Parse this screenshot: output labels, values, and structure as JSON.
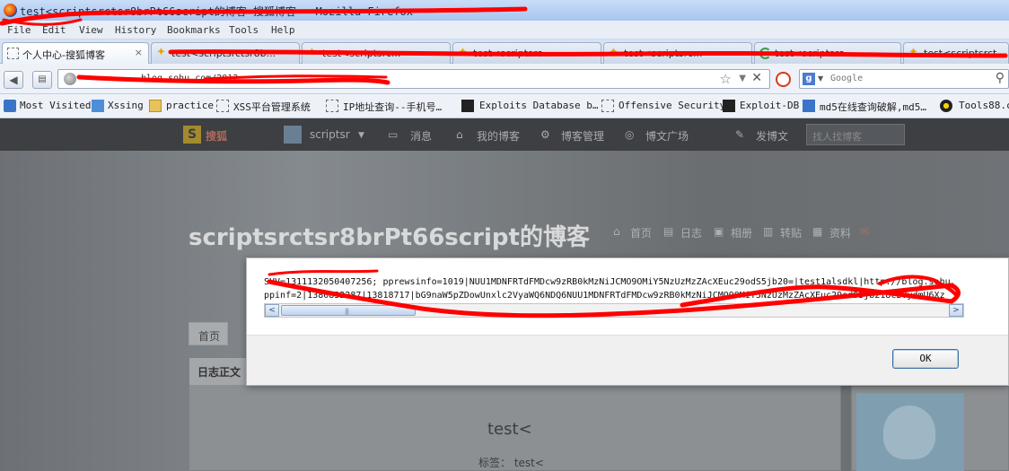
{
  "window": {
    "title": "test<scriptsrctsr8brPt66script的博客-搜狐博客 - Mozilla Firefox"
  },
  "menu": {
    "items": [
      "File",
      "Edit",
      "View",
      "History",
      "Bookmarks",
      "Tools",
      "Help"
    ]
  },
  "tabs": [
    {
      "label": "个人中心-搜狐博客",
      "close": "×"
    },
    {
      "label": "test<scriptsrctsr8b...",
      "close": ""
    },
    {
      "label": "test<scriptsrc...",
      "close": ""
    },
    {
      "label": "test<scriptsrc...",
      "close": ""
    },
    {
      "label": "test<scriptsrc...",
      "close": ""
    },
    {
      "label": "test<scriptsrc...",
      "close": ""
    },
    {
      "label": "test<scriptsrct",
      "close": ""
    }
  ],
  "nav": {
    "url": "blog.sohu.com/2012...",
    "search_placeholder": "Google",
    "search_engine_letter": "g"
  },
  "bookmarks": [
    "Most Visited",
    "Xssing",
    "practice",
    "XSS平台管理系统",
    "IP地址查询--手机号…",
    "Exploits Database b…",
    "Offensive Security",
    "Exploit-DB",
    "md5在线查询破解,md5…",
    "Tools88.c"
  ],
  "site_nav": {
    "logo": "搜狐",
    "username": "scriptsr",
    "items": [
      "消息",
      "我的博客",
      "博客管理",
      "博文广场",
      "发博文"
    ],
    "search_placeholder": "找人找博客"
  },
  "blog": {
    "title": "scriptsrctsr8brPt66script的博客",
    "nav": [
      "首页",
      "日志",
      "相册",
      "转贴",
      "资料"
    ],
    "home_tab": "首页",
    "content_header": "日志正文",
    "post_title": "test<",
    "post_tags": "标签： test<"
  },
  "dialog": {
    "cookie_line1": "SUV=1311132050407256; pprewsinfo=1019|NUU1MDNFRTdFMDcw9zRB0kMzNiJCMO9OMiY5NzUzMzZAcXEuc29odS5jb20=|test1alsdkl|http://blog.sohu.",
    "cookie_line2": "ppinf=2|1380832287|13818717|bG9naW5pZDowUnxlc2VyaWQ6NDQ6NUU1MDNFRTdFMDcw9zRB0kMzNiJCMO9OMiY5NzUzMzZAcXEuc29odS5jb218c2VydmU6Xz",
    "ok_label": "OK",
    "scroll_left": "<",
    "scroll_right": ">",
    "scroll_grip": "|||"
  },
  "colors": {
    "redaction": "#ff0000",
    "dialog_bg": "#f0f0f0",
    "site_bar": "#3d3f42"
  }
}
